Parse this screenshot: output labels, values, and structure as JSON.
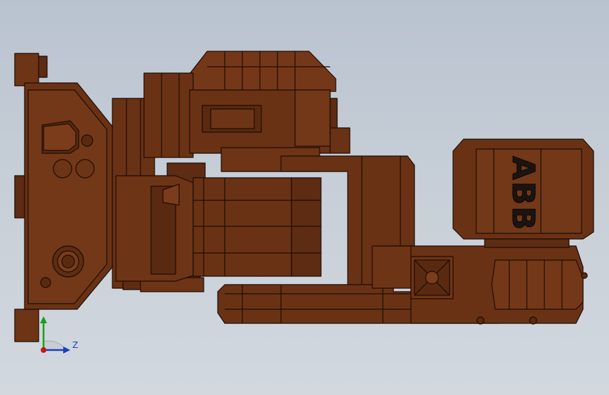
{
  "viewport": {
    "background_top": "#b9c3cf",
    "background_bottom": "#d2d8de"
  },
  "model": {
    "part_color": "#6a3214",
    "edge_color": "#1e0c04",
    "logo_text": "ABB"
  },
  "triad": {
    "z_label": "Z",
    "y_axis_color": "#1aa01a",
    "z_axis_color": "#1a3fbf",
    "origin_color": "#c01818"
  }
}
